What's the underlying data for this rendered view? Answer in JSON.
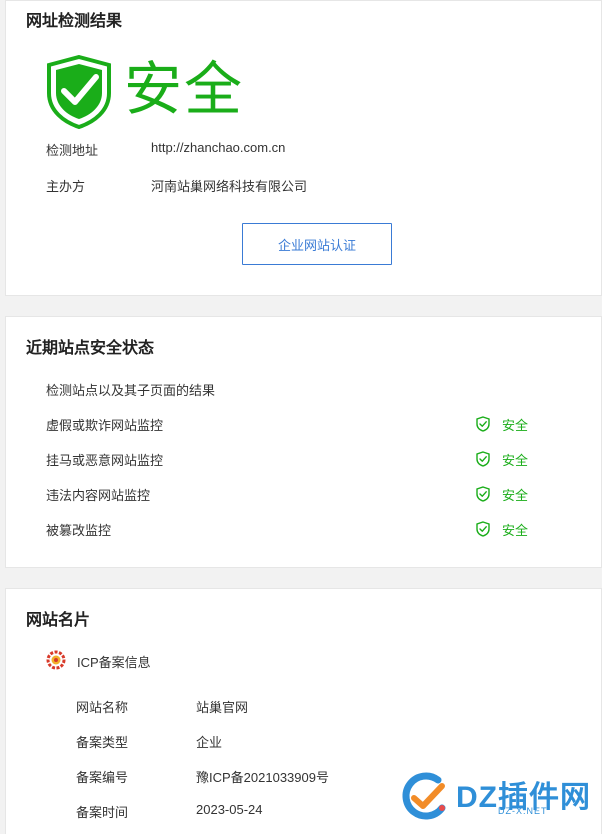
{
  "result": {
    "title": "网址检测结果",
    "status": "安全",
    "url_label": "检测地址",
    "url_value": "http://zhanchao.com.cn",
    "owner_label": "主办方",
    "owner_value": "河南站巢网络科技有限公司",
    "cert_button": "企业网站认证"
  },
  "security": {
    "title": "近期站点安全状态",
    "intro": "检测站点以及其子页面的结果",
    "items": [
      {
        "name": "虚假或欺诈网站监控",
        "status": "安全"
      },
      {
        "name": "挂马或恶意网站监控",
        "status": "安全"
      },
      {
        "name": "违法内容网站监控",
        "status": "安全"
      },
      {
        "name": "被篡改监控",
        "status": "安全"
      }
    ]
  },
  "site_card": {
    "title": "网站名片",
    "icp_title": "ICP备案信息",
    "rows": [
      {
        "label": "网站名称",
        "value": "站巢官网"
      },
      {
        "label": "备案类型",
        "value": "企业"
      },
      {
        "label": "备案编号",
        "value": "豫ICP备2021033909号"
      },
      {
        "label": "备案时间",
        "value": "2023-05-24"
      }
    ]
  },
  "watermark": {
    "text": "DZ插件网",
    "sub": "DZ-X.NET"
  },
  "colors": {
    "safe_green": "#1aad19",
    "link_blue": "#3a7bd5"
  }
}
